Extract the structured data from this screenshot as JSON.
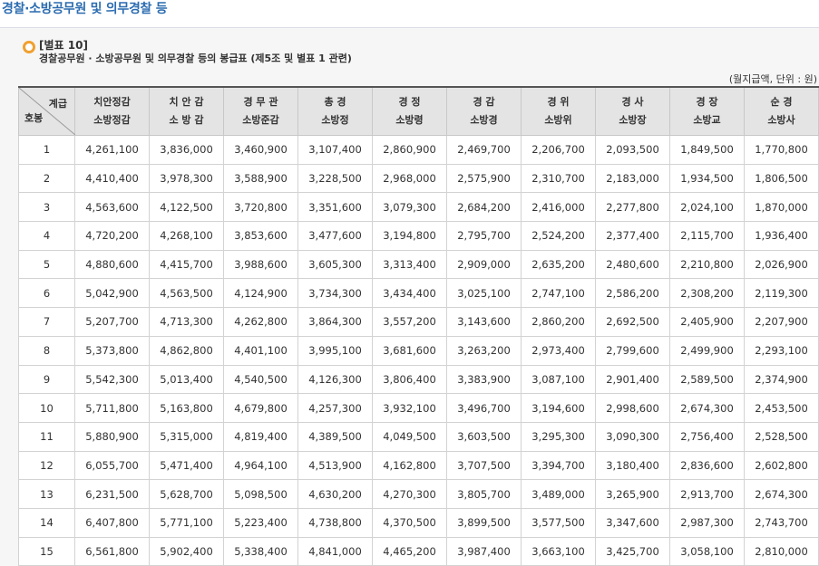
{
  "page_title": "경찰·소방공무원 및 의무경찰 등",
  "table_label": "[별표 10]",
  "table_subtitle": "경찰공무원 · 소방공무원 및 의무경찰 등의 봉급표 (제5조 및 별표 1 관련)",
  "unit_note": "(월지급액, 단위 : 원)",
  "corner_header": {
    "top": "계급",
    "bottom": "호봉"
  },
  "columns": [
    {
      "line1": "치안정감",
      "line2": "소방정감"
    },
    {
      "line1": "치 안 감",
      "line2": "소 방 감"
    },
    {
      "line1": "경 무 관",
      "line2": "소방준감"
    },
    {
      "line1": "총 경",
      "line2": "소방정"
    },
    {
      "line1": "경 정",
      "line2": "소방령"
    },
    {
      "line1": "경 감",
      "line2": "소방경"
    },
    {
      "line1": "경 위",
      "line2": "소방위"
    },
    {
      "line1": "경 사",
      "line2": "소방장"
    },
    {
      "line1": "경 장",
      "line2": "소방교"
    },
    {
      "line1": "순 경",
      "line2": "소방사"
    }
  ],
  "rows": [
    {
      "step": "1",
      "values": [
        "4,261,100",
        "3,836,000",
        "3,460,900",
        "3,107,400",
        "2,860,900",
        "2,469,700",
        "2,206,700",
        "2,093,500",
        "1,849,500",
        "1,770,800"
      ]
    },
    {
      "step": "2",
      "values": [
        "4,410,400",
        "3,978,300",
        "3,588,900",
        "3,228,500",
        "2,968,000",
        "2,575,900",
        "2,310,700",
        "2,183,000",
        "1,934,500",
        "1,806,500"
      ]
    },
    {
      "step": "3",
      "values": [
        "4,563,600",
        "4,122,500",
        "3,720,800",
        "3,351,600",
        "3,079,300",
        "2,684,200",
        "2,416,000",
        "2,277,800",
        "2,024,100",
        "1,870,000"
      ]
    },
    {
      "step": "4",
      "values": [
        "4,720,200",
        "4,268,100",
        "3,853,600",
        "3,477,600",
        "3,194,800",
        "2,795,700",
        "2,524,200",
        "2,377,400",
        "2,115,700",
        "1,936,400"
      ]
    },
    {
      "step": "5",
      "values": [
        "4,880,600",
        "4,415,700",
        "3,988,600",
        "3,605,300",
        "3,313,400",
        "2,909,000",
        "2,635,200",
        "2,480,600",
        "2,210,800",
        "2,026,900"
      ]
    },
    {
      "step": "6",
      "values": [
        "5,042,900",
        "4,563,500",
        "4,124,900",
        "3,734,300",
        "3,434,400",
        "3,025,100",
        "2,747,100",
        "2,586,200",
        "2,308,200",
        "2,119,300"
      ]
    },
    {
      "step": "7",
      "values": [
        "5,207,700",
        "4,713,300",
        "4,262,800",
        "3,864,300",
        "3,557,200",
        "3,143,600",
        "2,860,200",
        "2,692,500",
        "2,405,900",
        "2,207,900"
      ]
    },
    {
      "step": "8",
      "values": [
        "5,373,800",
        "4,862,800",
        "4,401,100",
        "3,995,100",
        "3,681,600",
        "3,263,200",
        "2,973,400",
        "2,799,600",
        "2,499,900",
        "2,293,100"
      ]
    },
    {
      "step": "9",
      "values": [
        "5,542,300",
        "5,013,400",
        "4,540,500",
        "4,126,300",
        "3,806,400",
        "3,383,900",
        "3,087,100",
        "2,901,400",
        "2,589,500",
        "2,374,900"
      ]
    },
    {
      "step": "10",
      "values": [
        "5,711,800",
        "5,163,800",
        "4,679,800",
        "4,257,300",
        "3,932,100",
        "3,496,700",
        "3,194,600",
        "2,998,600",
        "2,674,300",
        "2,453,500"
      ]
    },
    {
      "step": "11",
      "values": [
        "5,880,900",
        "5,315,000",
        "4,819,400",
        "4,389,500",
        "4,049,500",
        "3,603,500",
        "3,295,300",
        "3,090,300",
        "2,756,400",
        "2,528,500"
      ]
    },
    {
      "step": "12",
      "values": [
        "6,055,700",
        "5,471,400",
        "4,964,100",
        "4,513,900",
        "4,162,800",
        "3,707,500",
        "3,394,700",
        "3,180,400",
        "2,836,600",
        "2,602,800"
      ]
    },
    {
      "step": "13",
      "values": [
        "6,231,500",
        "5,628,700",
        "5,098,500",
        "4,630,200",
        "4,270,300",
        "3,805,700",
        "3,489,000",
        "3,265,900",
        "2,913,700",
        "2,674,300"
      ]
    },
    {
      "step": "14",
      "values": [
        "6,407,800",
        "5,771,100",
        "5,223,400",
        "4,738,800",
        "4,370,500",
        "3,899,500",
        "3,577,500",
        "3,347,600",
        "2,987,300",
        "2,743,700"
      ]
    },
    {
      "step": "15",
      "values": [
        "6,561,800",
        "5,902,400",
        "5,338,400",
        "4,841,000",
        "4,465,200",
        "3,987,400",
        "3,663,100",
        "3,425,700",
        "3,058,100",
        "2,810,000"
      ]
    }
  ]
}
